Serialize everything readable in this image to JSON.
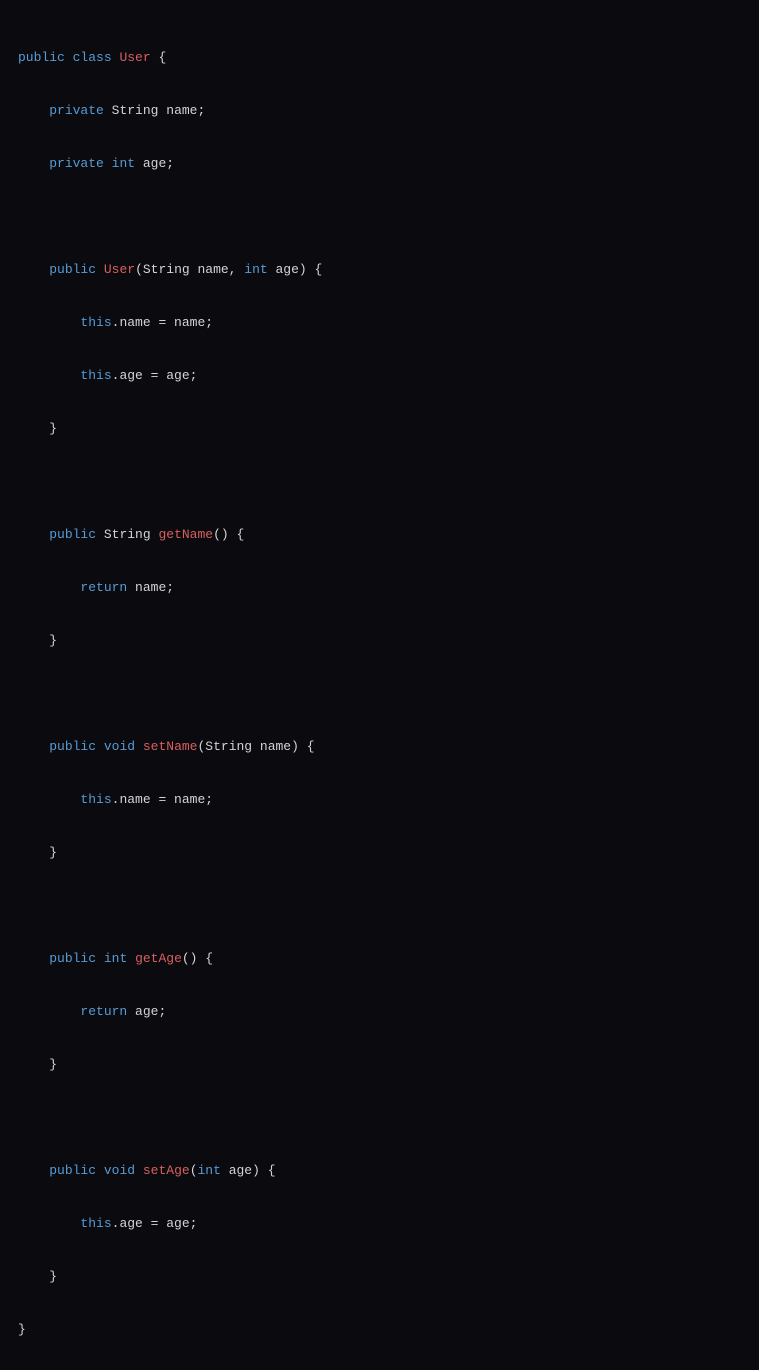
{
  "code": {
    "line1": {
      "public": "public",
      "class": "class",
      "className": "User",
      "brace": " {"
    },
    "line2": {
      "indent": "    ",
      "private": "private",
      "type": "String",
      "name": "name",
      "semi": ";"
    },
    "line3": {
      "indent": "    ",
      "private": "private",
      "type": "int",
      "name": "age",
      "semi": ";"
    },
    "line5": {
      "indent": "    ",
      "public": "public",
      "constructor": "User",
      "params": "(String name, ",
      "intType": "int",
      "params2": " age) {"
    },
    "line6": {
      "indent": "        ",
      "this": "this",
      "rest": ".name = name;"
    },
    "line7": {
      "indent": "        ",
      "this": "this",
      "rest": ".age = age;"
    },
    "line8": {
      "indent": "    ",
      "brace": "}"
    },
    "line10": {
      "indent": "    ",
      "public": "public",
      "returnType": "String",
      "method": "getName",
      "rest": "() {"
    },
    "line11": {
      "indent": "        ",
      "return": "return",
      "rest": " name;"
    },
    "line12": {
      "indent": "    ",
      "brace": "}"
    },
    "line14": {
      "indent": "    ",
      "public": "public",
      "void": "void",
      "method": "setName",
      "rest": "(String name) {"
    },
    "line15": {
      "indent": "        ",
      "this": "this",
      "rest": ".name = name;"
    },
    "line16": {
      "indent": "    ",
      "brace": "}"
    },
    "line18": {
      "indent": "    ",
      "public": "public",
      "intType": "int",
      "method": "getAge",
      "rest": "() {"
    },
    "line19": {
      "indent": "        ",
      "return": "return",
      "rest": " age;"
    },
    "line20": {
      "indent": "    ",
      "brace": "}"
    },
    "line22": {
      "indent": "    ",
      "public": "public",
      "void": "void",
      "method": "setAge",
      "params": "(",
      "intType": "int",
      "params2": " age) {"
    },
    "line23": {
      "indent": "        ",
      "this": "this",
      "rest": ".age = age;"
    },
    "line24": {
      "indent": "    ",
      "brace": "}"
    },
    "line25": {
      "brace": "}"
    }
  }
}
